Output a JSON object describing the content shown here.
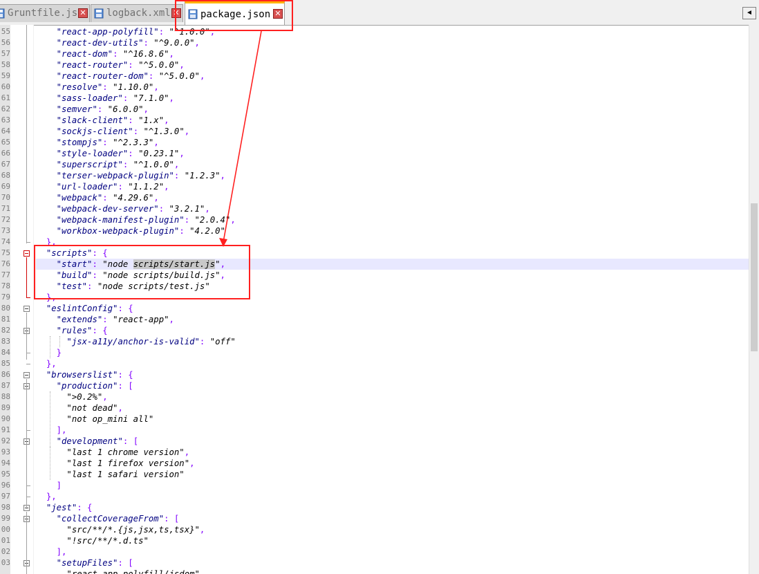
{
  "tabs": [
    {
      "label": "Gruntfile.js",
      "icon": "file-icon",
      "active": false
    },
    {
      "label": "logback.xml",
      "icon": "file-icon",
      "active": false
    },
    {
      "label": "package.json",
      "icon": "file-icon",
      "active": true
    }
  ],
  "tab_scroll_left_label": "◄",
  "editor": {
    "first_line_number": 55,
    "line_numbers": [
      "55",
      "56",
      "57",
      "58",
      "59",
      "60",
      "61",
      "62",
      "63",
      "64",
      "65",
      "66",
      "67",
      "68",
      "69",
      "70",
      "71",
      "72",
      "73",
      "74",
      "75",
      "76",
      "77",
      "78",
      "79",
      "80",
      "81",
      "82",
      "83",
      "84",
      "85",
      "86",
      "87",
      "88",
      "89",
      "90",
      "91",
      "92",
      "93",
      "94",
      "95",
      "96",
      "97",
      "98",
      "99",
      "00",
      "01",
      "02",
      "03"
    ],
    "lines": [
      "    \"react-app-polyfill\": \"^1.0.0\",",
      "    \"react-dev-utils\": \"^9.0.0\",",
      "    \"react-dom\": \"^16.8.6\",",
      "    \"react-router\": \"^5.0.0\",",
      "    \"react-router-dom\": \"^5.0.0\",",
      "    \"resolve\": \"1.10.0\",",
      "    \"sass-loader\": \"7.1.0\",",
      "    \"semver\": \"6.0.0\",",
      "    \"slack-client\": \"1.x\",",
      "    \"sockjs-client\": \"^1.3.0\",",
      "    \"stompjs\": \"^2.3.3\",",
      "    \"style-loader\": \"0.23.1\",",
      "    \"superscript\": \"^1.0.0\",",
      "    \"terser-webpack-plugin\": \"1.2.3\",",
      "    \"url-loader\": \"1.1.2\",",
      "    \"webpack\": \"4.29.6\",",
      "    \"webpack-dev-server\": \"3.2.1\",",
      "    \"webpack-manifest-plugin\": \"2.0.4\",",
      "    \"workbox-webpack-plugin\": \"4.2.0\"",
      "  },",
      "  \"scripts\": {",
      "    \"start\": \"node scripts/start.js\",",
      "    \"build\": \"node scripts/build.js\",",
      "    \"test\": \"node scripts/test.js\"",
      "  },",
      "  \"eslintConfig\": {",
      "    \"extends\": \"react-app\",",
      "    \"rules\": {",
      "      \"jsx-a11y/anchor-is-valid\": \"off\"",
      "    }",
      "  },",
      "  \"browserslist\": {",
      "    \"production\": [",
      "      \">0.2%\",",
      "      \"not dead\",",
      "      \"not op_mini all\"",
      "    ],",
      "    \"development\": [",
      "      \"last 1 chrome version\",",
      "      \"last 1 firefox version\",",
      "      \"last 1 safari version\"",
      "    ]",
      "  },",
      "  \"jest\": {",
      "    \"collectCoverageFrom\": [",
      "      \"src/**/*.{js,jsx,ts,tsx}\",",
      "      \"!src/**/*.d.ts\"",
      "    ],",
      "    \"setupFiles\": [",
      "      \"react-app-polyfill/jsdom\""
    ],
    "current_line_number": "76",
    "selected_text": "scripts/start.js",
    "fold_markers_at": [
      "75",
      "80",
      "82",
      "86",
      "87",
      "92",
      "98",
      "99",
      "03"
    ]
  },
  "annotation_color": "#ff2020"
}
